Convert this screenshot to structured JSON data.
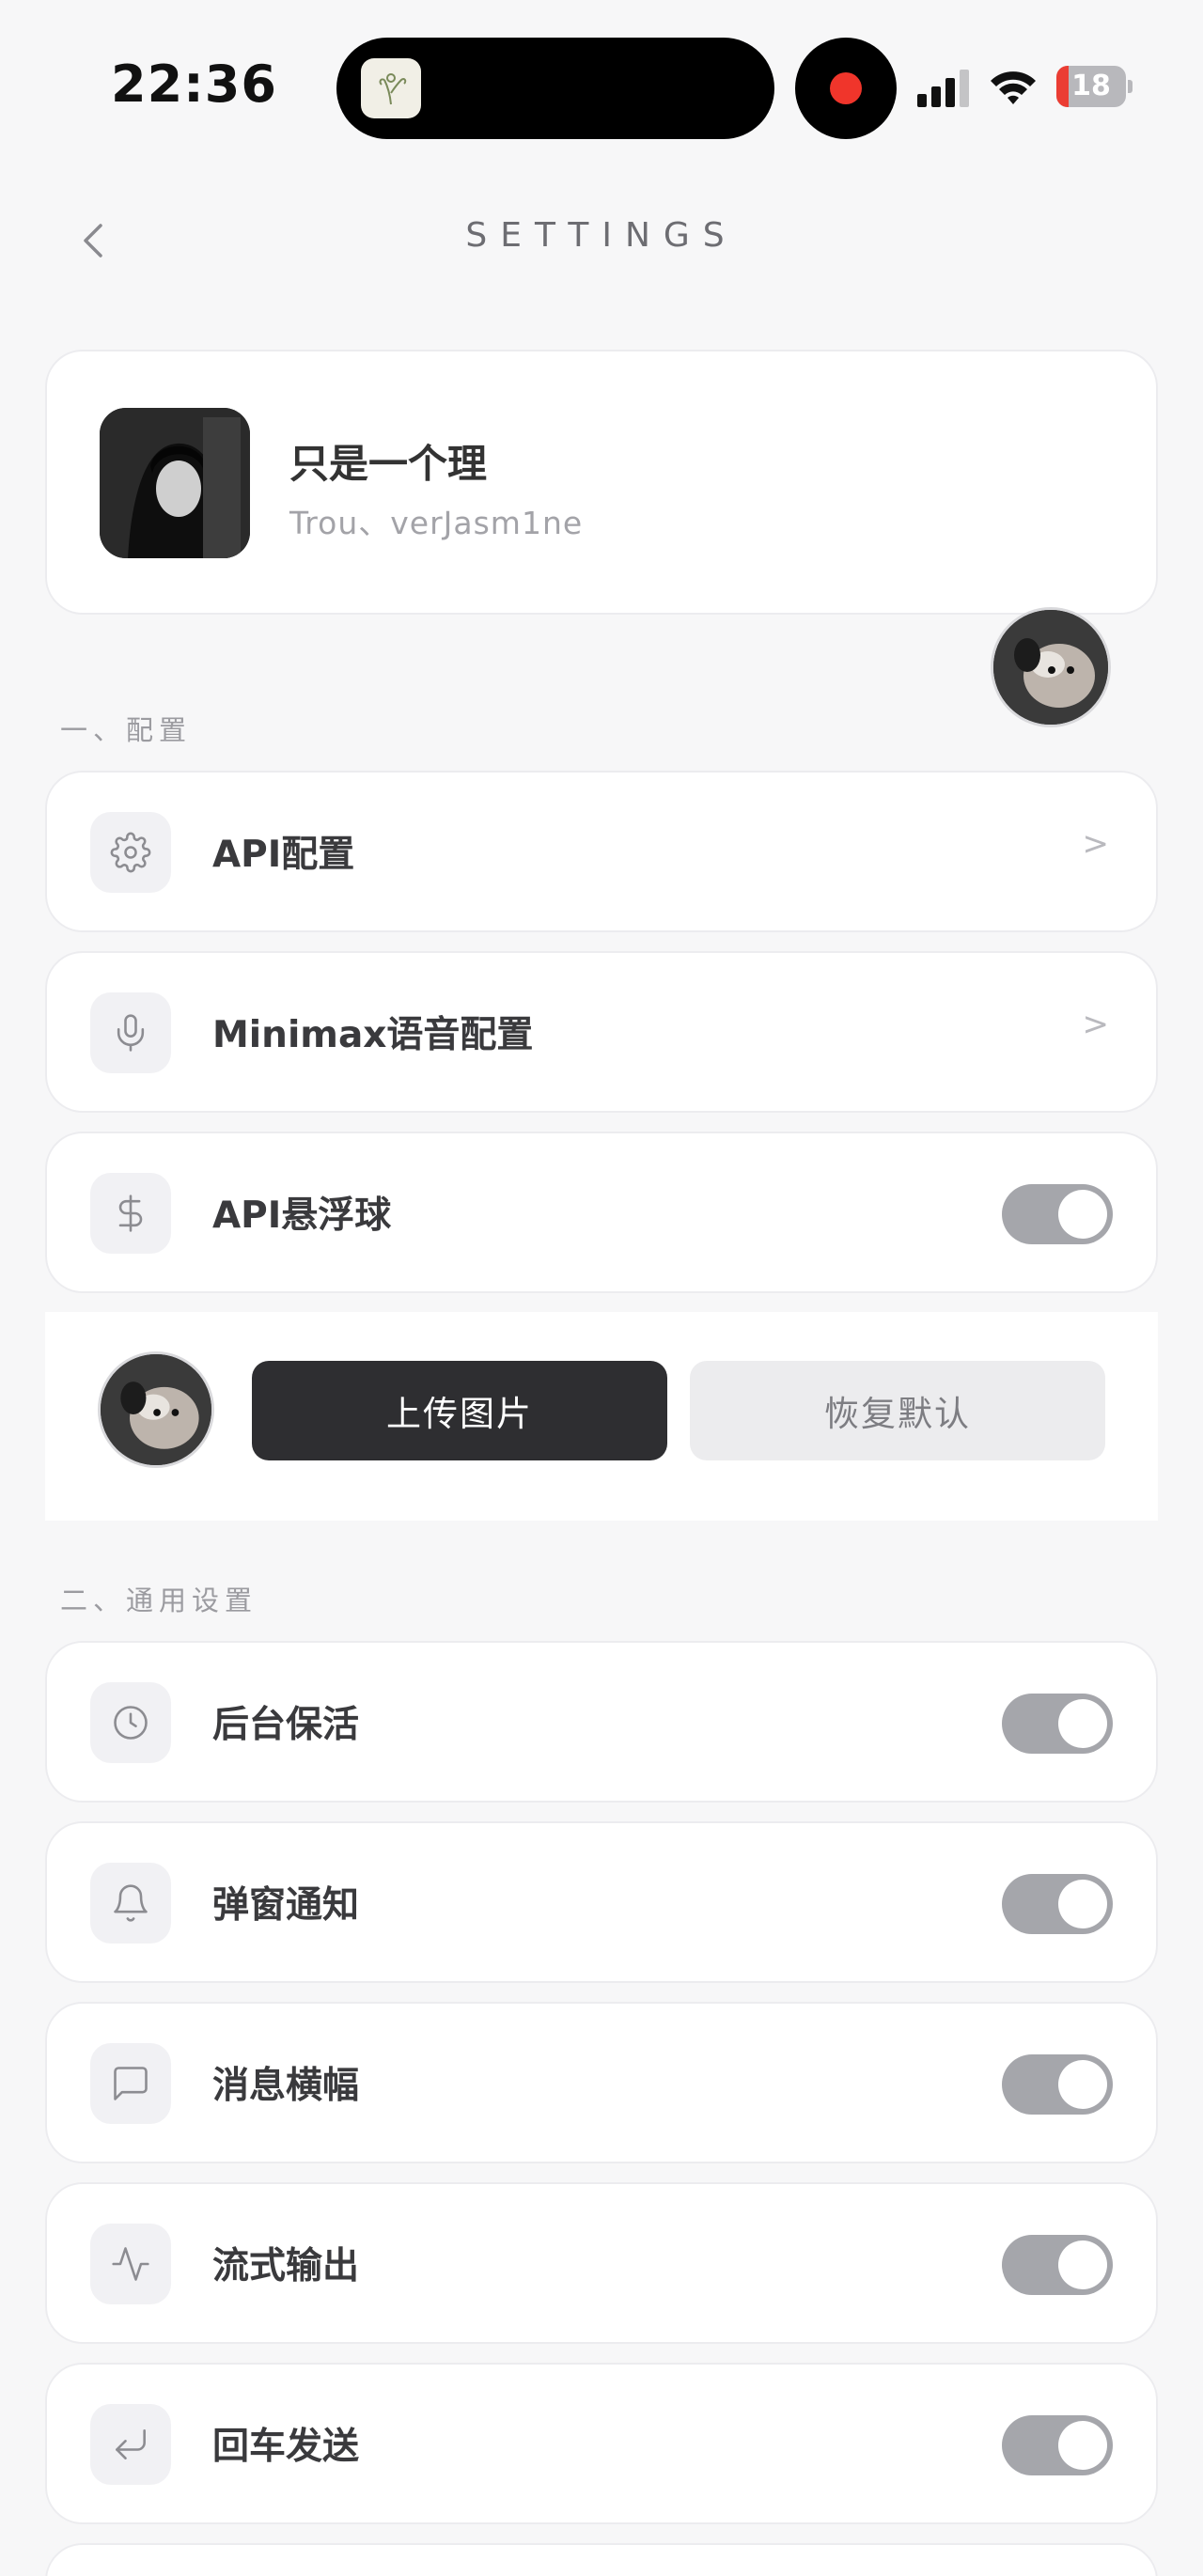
{
  "status_bar": {
    "time": "22:36",
    "battery_level": "18",
    "battery_fraction": 0.18
  },
  "header": {
    "title": "SETTINGS",
    "back_icon": "chevron-left-icon"
  },
  "profile": {
    "name": "只是一个理",
    "handle": "Trou、verJasm1ne"
  },
  "sections": {
    "config_label": "一、配置",
    "general_label": "二、通用设置"
  },
  "config_items": [
    {
      "label": "API配置",
      "icon": "gear-icon",
      "control": "chevron",
      "chevron": ">"
    },
    {
      "label": "Minimax语音配置",
      "icon": "microphone-icon",
      "control": "chevron",
      "chevron": ">"
    },
    {
      "label": "API悬浮球",
      "icon": "dollar-icon",
      "control": "toggle",
      "on": true
    }
  ],
  "upload": {
    "upload_label": "上传图片",
    "reset_label": "恢复默认"
  },
  "general_items": [
    {
      "label": "后台保活",
      "icon": "clock-icon",
      "on": true
    },
    {
      "label": "弹窗通知",
      "icon": "bell-icon",
      "on": true
    },
    {
      "label": "消息横幅",
      "icon": "message-icon",
      "on": true
    },
    {
      "label": "流式输出",
      "icon": "activity-icon",
      "on": true
    },
    {
      "label": "回车发送",
      "icon": "enter-icon",
      "on": true
    }
  ],
  "colors": {
    "toggle_on": "#a5a6ab",
    "primary_button": "#2e2e31",
    "recording": "#f0352b",
    "battery_low": "#eb3d33"
  }
}
